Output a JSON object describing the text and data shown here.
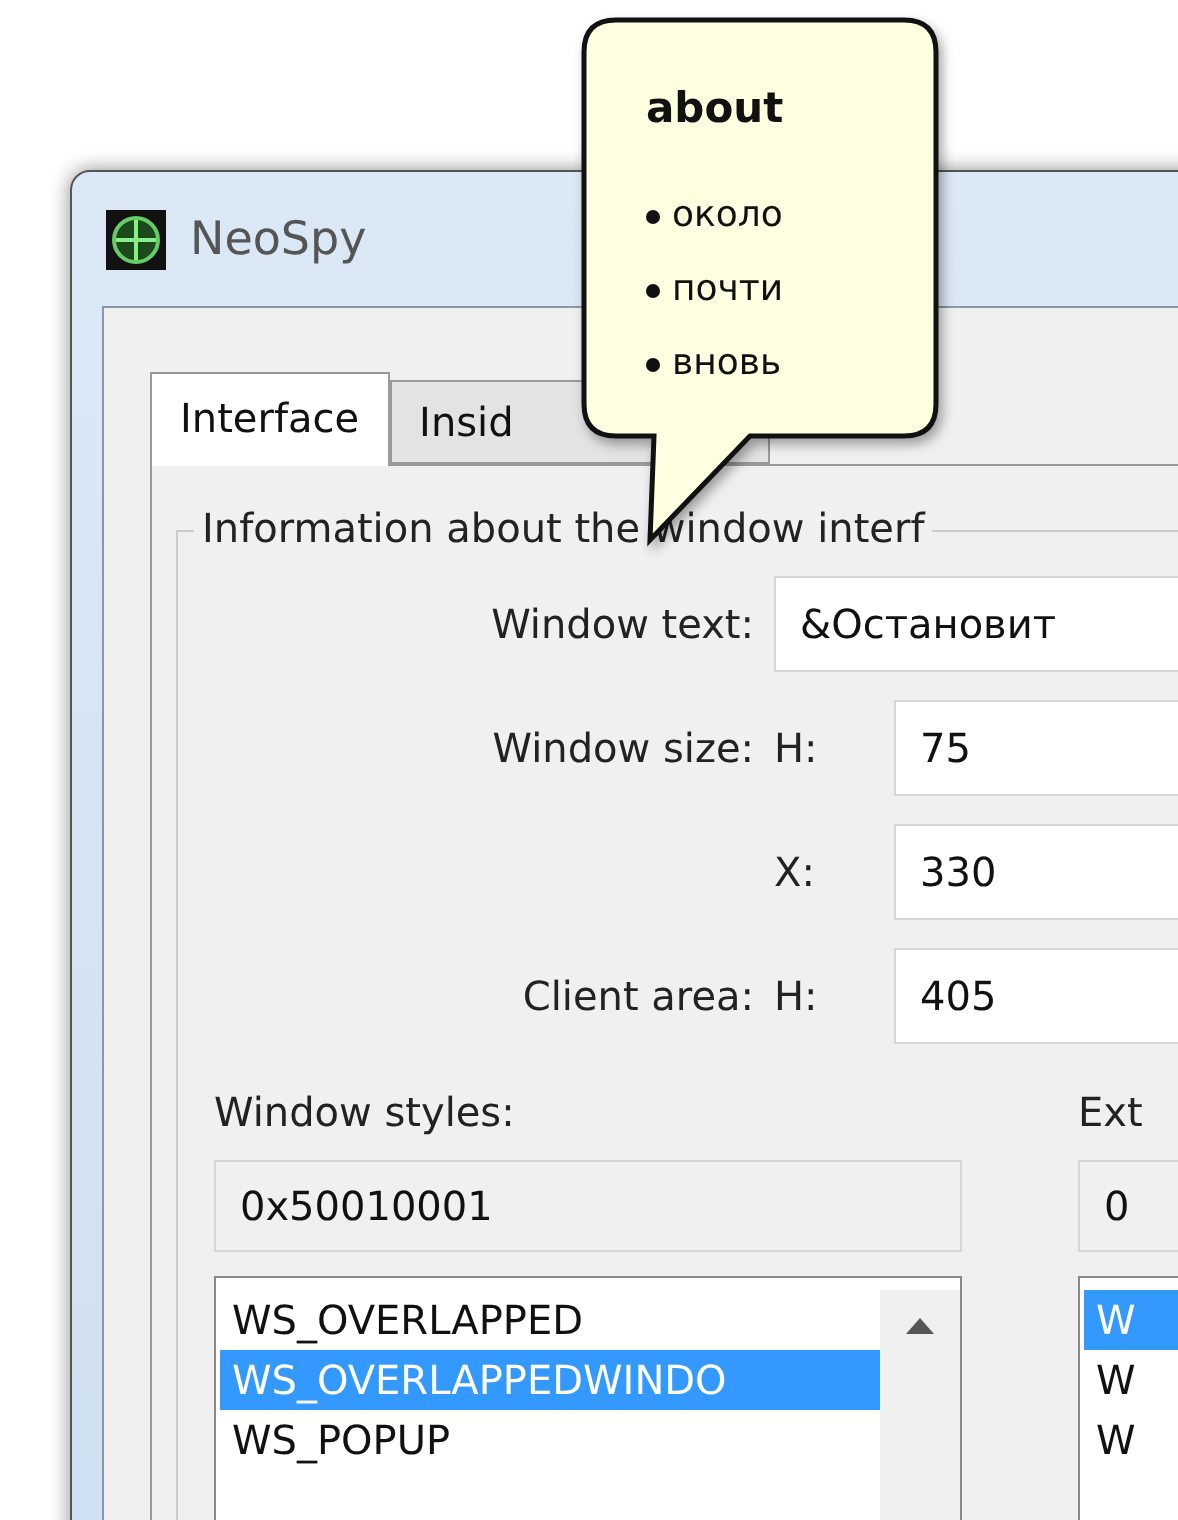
{
  "window": {
    "title": "NeoSpy"
  },
  "tabs": [
    {
      "label": "Interface",
      "selected": true
    },
    {
      "label": "Insid",
      "selected": false
    }
  ],
  "tooltip": {
    "title": "about",
    "items": [
      "около",
      "почти",
      "вновь"
    ]
  },
  "group": {
    "title": "Information about the window interf",
    "rows": [
      {
        "kind": "text",
        "label": "Window text:",
        "value": "&Остановит"
      },
      {
        "kind": "pair",
        "label": "Window size:",
        "prefix": "H:",
        "value": "75"
      },
      {
        "kind": "pair",
        "prefix": "X:",
        "value": "330"
      },
      {
        "kind": "pair",
        "label": "Client area:",
        "prefix": "H:",
        "value": "405"
      }
    ]
  },
  "styles": {
    "label": "Window styles:",
    "value": "0x50010001",
    "items": [
      {
        "text": "WS_OVERLAPPED",
        "selected": false
      },
      {
        "text": "WS_OVERLAPPEDWINDO",
        "selected": true
      },
      {
        "text": "WS_POPUP",
        "selected": false
      }
    ]
  },
  "ex_styles": {
    "label": "Ext",
    "value": "0",
    "items": [
      {
        "text": "W",
        "selected": true
      },
      {
        "text": "W",
        "selected": false
      },
      {
        "text": "W",
        "selected": false
      }
    ]
  }
}
